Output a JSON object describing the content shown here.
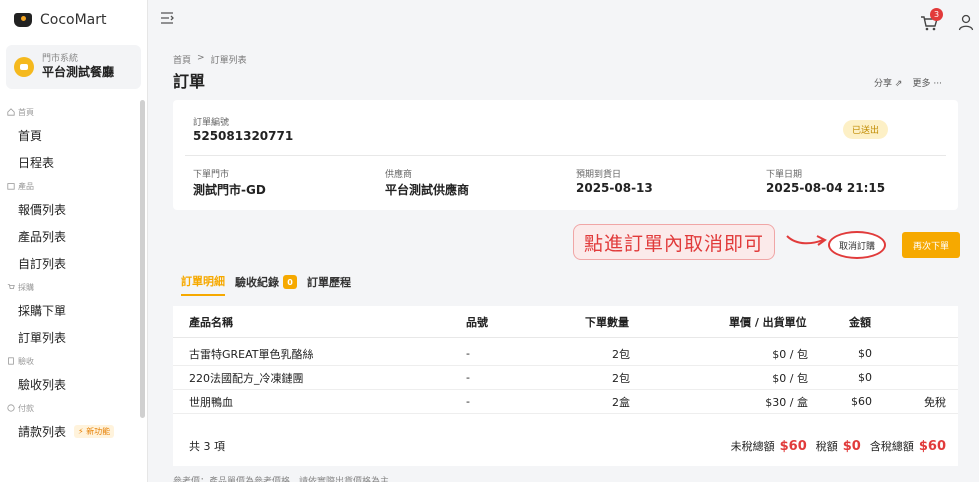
{
  "app": {
    "logo_text": "CocoMart"
  },
  "store": {
    "system_label": "門市系統",
    "name": "平台測試餐廳"
  },
  "sidebar": {
    "groups": [
      {
        "label": "首頁",
        "items": [
          "首頁",
          "日程表"
        ]
      },
      {
        "label": "產品",
        "items": [
          "報價列表",
          "產品列表",
          "自訂列表"
        ]
      },
      {
        "label": "採購",
        "items": [
          "採購下單",
          "訂單列表"
        ]
      },
      {
        "label": "驗收",
        "items": [
          "驗收列表"
        ]
      },
      {
        "label": "付款",
        "items": [
          "請款列表"
        ]
      }
    ],
    "new_badge": "新功能"
  },
  "topbar": {
    "cart_count": "3"
  },
  "breadcrumb": {
    "home": "首頁",
    "sep": ">",
    "current": "訂單列表"
  },
  "page": {
    "title": "訂單",
    "share": "分享",
    "more": "更多"
  },
  "order": {
    "no_label": "訂單編號",
    "no_value": "525081320771",
    "status": "已送出",
    "store_label": "下單門市",
    "store_value": "測試門市-GD",
    "supplier_label": "供應商",
    "supplier_value": "平台測試供應商",
    "eta_label": "預期到貨日",
    "eta_value": "2025-08-13",
    "date_label": "下單日期",
    "date_value": "2025-08-04 21:15"
  },
  "annotation": {
    "text": "點進訂單內取消即可"
  },
  "buttons": {
    "cancel": "取消訂購",
    "reorder": "再次下單"
  },
  "tabs": {
    "detail": "訂單明細",
    "receipts": "驗收紀錄",
    "receipts_count": "0",
    "history": "訂單歷程"
  },
  "table": {
    "headers": {
      "name": "產品名稱",
      "sku": "品號",
      "qty": "下單數量",
      "price": "單價 / 出貨單位",
      "amount": "金額"
    },
    "rows": [
      {
        "name": "古雷特GREAT單色乳酪絲",
        "sku": "-",
        "qty": "2包",
        "price": "$0 / 包",
        "amount": "$0",
        "tax": ""
      },
      {
        "name": "220法國配方_冷凍鏈團",
        "sku": "-",
        "qty": "2包",
        "price": "$0 / 包",
        "amount": "$0",
        "tax": ""
      },
      {
        "name": "世朋鴨血",
        "sku": "-",
        "qty": "2盒",
        "price": "$30 / 盒",
        "amount": "$60",
        "tax": "免稅"
      }
    ],
    "footer": {
      "count": "共 3 項",
      "untaxed_label": "未稅總額",
      "untaxed": "$60",
      "tax_label": "稅額",
      "tax": "$0",
      "total_label": "含稅總額",
      "total": "$60"
    }
  },
  "note": "參考價：產品單價為參考價格，請依實際出貨價格為主。"
}
